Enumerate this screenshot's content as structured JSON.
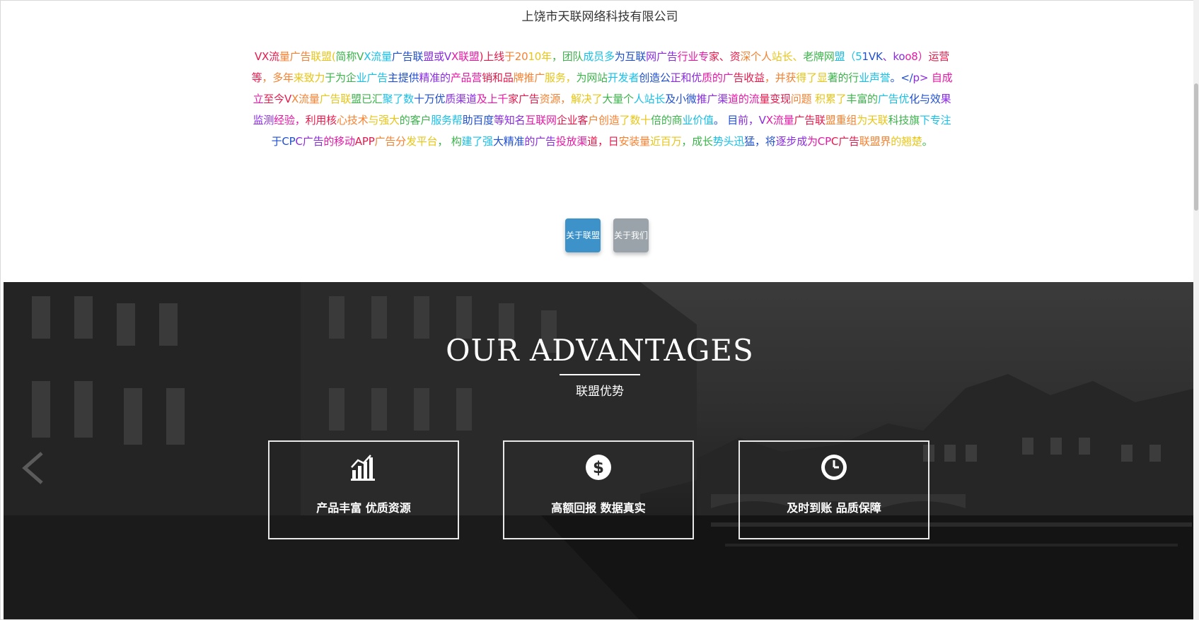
{
  "company_name": "上饶市天联网络科技有限公司",
  "intro_text": "VX流量广告联盟(简称VX流量广告联盟或VX联盟)上线于2010年，团队成员多为互联网广告行业专家、资深个人站长、老牌网盟（51VK、koo8）运营等，多年来致力于为企业广告主提供精准的产品营销和品牌推广服务，为网站开发者创造公正和优质的广告收益，并获得了显著的行业声誉。</p> 自成立至今VX流量广告联盟已汇聚了数十万优质渠道及上千家广告资源，解决了大量个人站长及小微推广渠道的流量变现问题 积累了丰富的广告优化与效果监测经验，利用核心技术与强大的客户服务帮助百度等知名互联网企业客户创造了数十倍的商业价值。 目前，VX流量广告联盟重组为天联科技旗下专注于CPC广告的移动APP广告分发平台， 构建了强大精准的广告投放渠道，日安装量近百万，成长势头迅猛，将逐步成为CPC广告联盟界的翘楚。",
  "rainbow_colors": [
    "#e6194b",
    "#f58231",
    "#e6c619",
    "#3cb44b",
    "#19c0e6",
    "#1f4fd1",
    "#8a2be2",
    "#e619a6"
  ],
  "buttons": {
    "about_alliance": "关于联盟",
    "about_us": "关于我们",
    "about_alliance_color": "#3d93c9",
    "about_us_color": "#9aa3aa"
  },
  "advantages": {
    "title": "OUR ADVANTAGES",
    "subtitle": "联盟优势",
    "cards": [
      {
        "icon": "bar-chart-icon",
        "label": "产品丰富 优质资源"
      },
      {
        "icon": "dollar-icon",
        "label": "高额回报  数据真实"
      },
      {
        "icon": "clock-icon",
        "label": "及时到账 品质保障"
      }
    ]
  }
}
